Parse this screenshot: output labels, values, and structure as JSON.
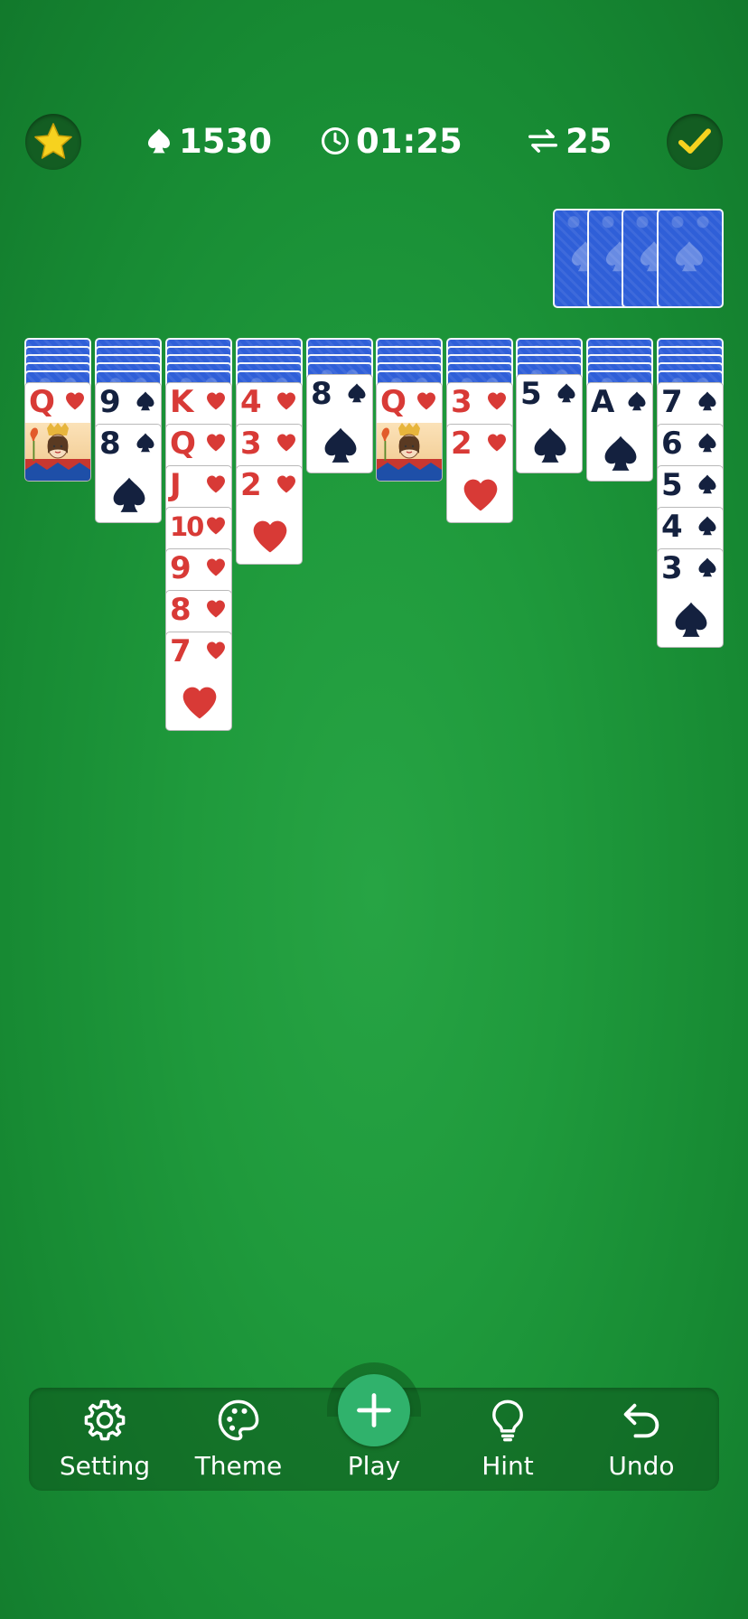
{
  "topbar": {
    "score": "1530",
    "time": "01:25",
    "moves": "25"
  },
  "stock": {
    "piles": 4
  },
  "tableau": [
    {
      "backs": 5,
      "cards": [
        {
          "rank": "Q",
          "suit": "hearts",
          "face": true
        }
      ]
    },
    {
      "backs": 5,
      "cards": [
        {
          "rank": "9",
          "suit": "spades"
        },
        {
          "rank": "8",
          "suit": "spades"
        }
      ]
    },
    {
      "backs": 5,
      "cards": [
        {
          "rank": "K",
          "suit": "hearts"
        },
        {
          "rank": "Q",
          "suit": "hearts"
        },
        {
          "rank": "J",
          "suit": "hearts"
        },
        {
          "rank": "10",
          "suit": "hearts"
        },
        {
          "rank": "9",
          "suit": "hearts"
        },
        {
          "rank": "8",
          "suit": "hearts"
        },
        {
          "rank": "7",
          "suit": "hearts"
        }
      ]
    },
    {
      "backs": 5,
      "cards": [
        {
          "rank": "4",
          "suit": "hearts"
        },
        {
          "rank": "3",
          "suit": "hearts"
        },
        {
          "rank": "2",
          "suit": "hearts"
        }
      ]
    },
    {
      "backs": 4,
      "cards": [
        {
          "rank": "8",
          "suit": "spades"
        }
      ]
    },
    {
      "backs": 5,
      "cards": [
        {
          "rank": "Q",
          "suit": "hearts",
          "face": true
        }
      ]
    },
    {
      "backs": 5,
      "cards": [
        {
          "rank": "3",
          "suit": "hearts"
        },
        {
          "rank": "2",
          "suit": "hearts"
        }
      ]
    },
    {
      "backs": 4,
      "cards": [
        {
          "rank": "5",
          "suit": "spades"
        }
      ]
    },
    {
      "backs": 5,
      "cards": [
        {
          "rank": "A",
          "suit": "spades"
        }
      ]
    },
    {
      "backs": 5,
      "cards": [
        {
          "rank": "7",
          "suit": "spades"
        },
        {
          "rank": "6",
          "suit": "spades"
        },
        {
          "rank": "5",
          "suit": "spades"
        },
        {
          "rank": "4",
          "suit": "spades"
        },
        {
          "rank": "3",
          "suit": "spades"
        }
      ]
    }
  ],
  "bottombar": {
    "setting": "Setting",
    "theme": "Theme",
    "play": "Play",
    "hint": "Hint",
    "undo": "Undo"
  },
  "colors": {
    "red_suit": "#d83a36",
    "black_suit": "#14213f",
    "card_back": "#2f5fd8",
    "felt": "#1f9a3c",
    "play_button": "#30b26c",
    "star": "#f6d21f",
    "check": "#f6d21f"
  }
}
